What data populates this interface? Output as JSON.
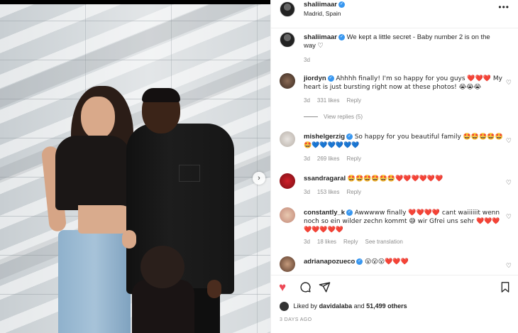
{
  "post": {
    "author": "shaliimaar",
    "location": "Madrid, Spain",
    "caption_user": "shaliimaar",
    "caption_text": "We kept a little secret - Baby number 2 is on the way ♡",
    "caption_age": "3d",
    "more_label": "•••"
  },
  "comments": [
    {
      "user": "jiordyn",
      "verified": true,
      "text": "Ahhhh finally! I'm so happy for you guys ❤️❤️❤️ My heart is just bursting right now at these photos! 😭😭😭",
      "age": "3d",
      "likes": "331 likes",
      "reply": "Reply",
      "view_replies": "View replies (5)"
    },
    {
      "user": "mishelgerzig",
      "verified": true,
      "text": "So happy for you beautiful family 🤩🤩🤩🤩🤩🤩💙💙💙💙💙💙",
      "age": "3d",
      "likes": "269 likes",
      "reply": "Reply"
    },
    {
      "user": "ssandragaral",
      "verified": false,
      "text": "🤩🤩🤩🤩🤩🤩❤️❤️❤️❤️❤️❤️",
      "age": "3d",
      "likes": "153 likes",
      "reply": "Reply"
    },
    {
      "user": "constantly_k",
      "verified": true,
      "text": "Awwwww finally ❤️❤️❤️❤️ cant waiiiiiit wenn noch so ein wilder zechn kommt 😅 wir Gfrei uns sehr ❤️❤️❤️❤️❤️❤️❤️❤️",
      "age": "3d",
      "likes": "18 likes",
      "reply": "Reply",
      "see_translation": "See translation"
    },
    {
      "user": "adrianapozueco",
      "verified": true,
      "text": "😮😮😮❤️❤️❤️"
    }
  ],
  "footer": {
    "liked_by_prefix": "Liked by",
    "liked_by_user": "davidalaba",
    "liked_by_and": "and",
    "liked_by_count": "51,499 others",
    "time_ago": "3 DAYS AGO"
  },
  "colors": {
    "like_red": "#ed4956",
    "verified_blue": "#3897f0",
    "muted_text": "#8e8e8e"
  }
}
